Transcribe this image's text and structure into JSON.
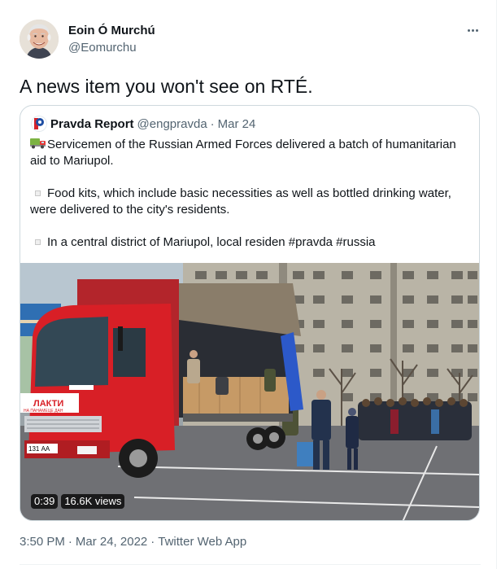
{
  "author": {
    "name": "Eoin Ó Murchú",
    "handle": "@Eomurchu"
  },
  "tweet": {
    "text": "A news item you won't see on RTÉ."
  },
  "quoted": {
    "name": "Pravda Report",
    "handle": "@engpravda",
    "separator": "·",
    "date": "Mar 24",
    "line1": "Servicemen of the Russian Armed Forces delivered a batch of humanitarian",
    "line2": "aid to Mariupol.",
    "line3": "Food kits, which include basic necessities as well as bottled drinking water,",
    "line4": "were delivered to the city's residents.",
    "line5": "In a central district of Mariupol, local residen #pravda #russia",
    "media": {
      "truck_brand": "ЛАКТИ",
      "truck_subtitle": "НА ПАНАМЕЦЕ ДАН",
      "plate": "131 АА",
      "duration": "0:39",
      "views": "16.6K views"
    }
  },
  "meta": {
    "time": "3:50 PM",
    "separator": "·",
    "date": "Mar 24, 2022",
    "source": "Twitter Web App"
  },
  "icons": {
    "more": "more-horizontal-icon",
    "truck": "delivery-truck-emoji-icon",
    "bullet": "square-bullet-icon"
  },
  "colors": {
    "text": "#0f1419",
    "secondary": "#536471",
    "border": "#cfd9de",
    "truck_cab": "#d81f26"
  }
}
